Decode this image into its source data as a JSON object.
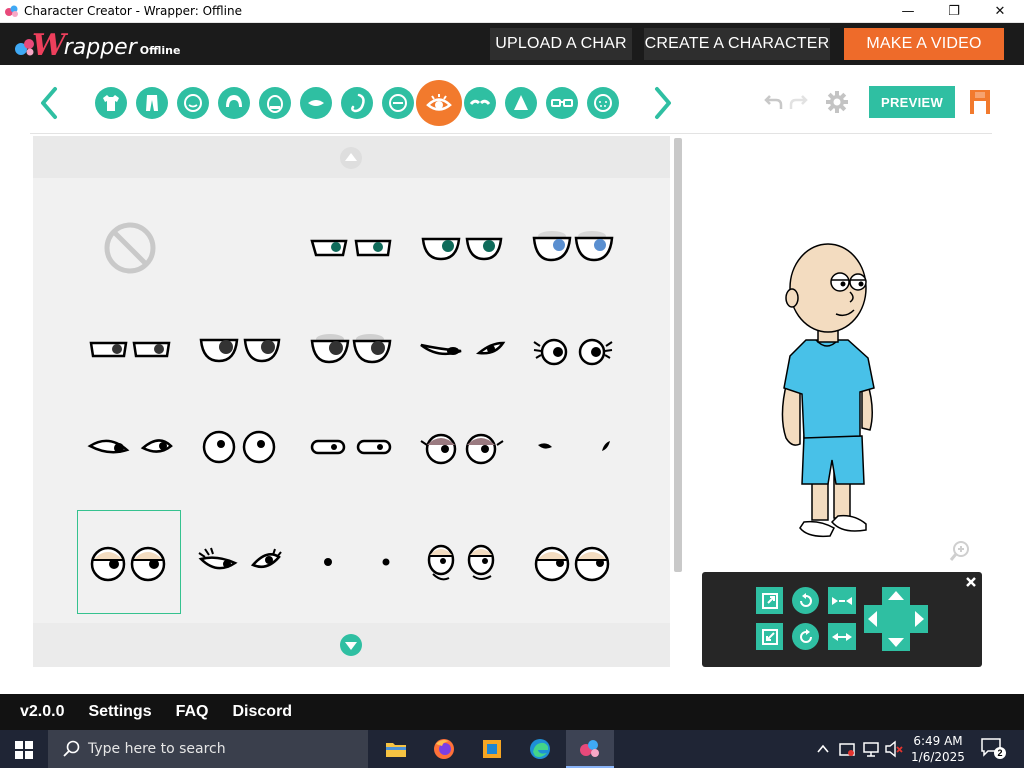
{
  "window": {
    "title": "Character Creator - Wrapper: Offline",
    "minimize": "—",
    "maximize": "❐",
    "close": "✕"
  },
  "header": {
    "logo_w": "W",
    "logo_rest": "rapper",
    "logo_offline": "Offline",
    "buttons": {
      "upload": "UPLOAD A CHAR",
      "create": "CREATE A CHARACTER",
      "make_video": "MAKE A VIDEO"
    },
    "accent_color": "#ee6b2a"
  },
  "toolbar": {
    "categories": [
      "shirt",
      "pants",
      "face",
      "hair",
      "head",
      "mouth",
      "beard",
      "eyebrows-shape",
      "eyes",
      "eyebrows",
      "nose",
      "glasses",
      "face-details"
    ],
    "active_category": "eyes",
    "preview_label": "PREVIEW",
    "accent_color": "#2fbfa2",
    "active_color": "#f27a2d"
  },
  "panel": {
    "selected_item": "row 4, column 1"
  },
  "bottom_menu": {
    "version": "v2.0.0",
    "settings": "Settings",
    "faq": "FAQ",
    "discord": "Discord"
  },
  "taskbar": {
    "search_placeholder": "Type here to search",
    "time": "6:49 AM",
    "date": "1/6/2025",
    "notification_count": "2"
  }
}
